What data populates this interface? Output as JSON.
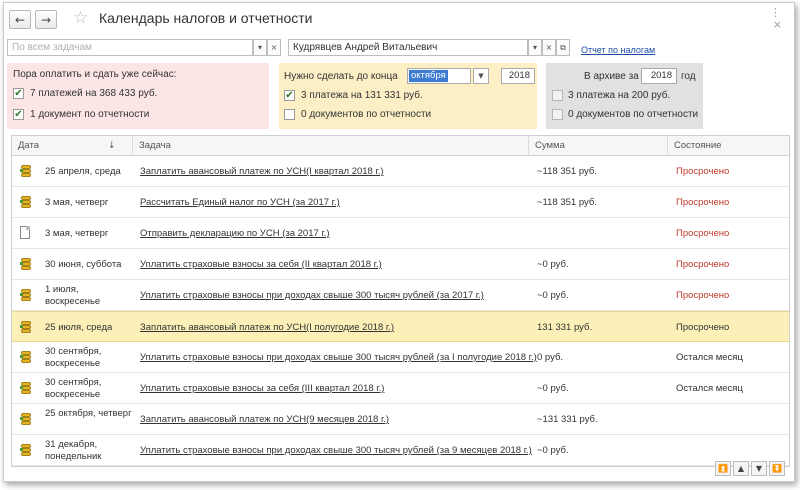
{
  "window": {
    "title": "Календарь налогов и отчетности"
  },
  "toolbar": {
    "back_glyph": "←",
    "forward_glyph": "→",
    "star_glyph": "☆",
    "more_glyph": "⋮",
    "close_glyph": "×"
  },
  "filter": {
    "task_placeholder": "По всем задачам",
    "person_value": "Кудрявцев Андрей Витальевич",
    "report_link": "Отчет по налогам"
  },
  "panel_now": {
    "label": "Пора оплатить и сдать уже сейчас:",
    "payments": "7 платежей на 368 433 руб.",
    "documents": "1 документ по отчетности"
  },
  "panel_todo": {
    "label": "Нужно сделать до конца",
    "month": "октября",
    "year": "2018",
    "payments": "3 платежа на 131 331 руб.",
    "documents": "0 документов по отчетности"
  },
  "panel_archive": {
    "label": "В архиве за",
    "year": "2018",
    "year_suffix": "год",
    "payments": "3 платежа на 200 руб.",
    "documents": "0 документов по отчетности"
  },
  "table": {
    "columns": {
      "date": "Дата",
      "task": "Задача",
      "sum": "Сумма",
      "state": "Состояние"
    },
    "rows": [
      {
        "date": "25 апреля, среда",
        "task": "Заплатить авансовый платеж по УСН(I квартал 2018 г.)",
        "sum": "~118 351 руб.",
        "state": "Просрочено",
        "icon": "coins-icon"
      },
      {
        "date": "3 мая, четверг",
        "task": "Рассчитать Единый налог по УСН (за 2017 г.)",
        "sum": "~118 351 руб.",
        "state": "Просрочено",
        "icon": "coins-icon"
      },
      {
        "date": "3 мая, четверг",
        "task": "Отправить декларацию по УСН (за 2017 г.)",
        "sum": "",
        "state": "Просрочено",
        "icon": "document-icon"
      },
      {
        "date": "30 июня, суббота",
        "task": "Уплатить страховые взносы за себя (II квартал 2018 г.)",
        "sum": "~0 руб.",
        "state": "Просрочено",
        "icon": "coins-icon"
      },
      {
        "date": "1 июля, воскресенье",
        "task": "Уплатить страховые взносы при доходах свыше 300 тысяч рублей (за 2017 г.)",
        "sum": "~0 руб.",
        "state": "Просрочено",
        "icon": "coins-icon"
      },
      {
        "date": "25 июля, среда",
        "task": "Заплатить авансовый платеж по УСН(I полугодие 2018 г.)",
        "sum": "131 331 руб.",
        "state": "Просрочено",
        "icon": "coins-icon"
      },
      {
        "date": "30 сентября, воскресенье",
        "task": "Уплатить страховые взносы при доходах свыше 300 тысяч рублей (за I полугодие 2018 г.)",
        "sum": "0 руб.",
        "state": "Остался месяц",
        "icon": "coins-icon"
      },
      {
        "date": "30 сентября, воскресенье",
        "task": "Уплатить страховые взносы за себя (III квартал 2018 г.)",
        "sum": "~0 руб.",
        "state": "Остался месяц",
        "icon": "coins-icon"
      },
      {
        "date": "25 октября, четверг",
        "task": "Заплатить авансовый платеж по УСН(9 месяцев 2018 г.)",
        "sum": "~131 331 руб.",
        "state": "",
        "icon": "coins-icon"
      },
      {
        "date": "31 декабря, понедельник",
        "task": "Уплатить страховые взносы при доходах свыше 300 тысяч рублей (за 9 месяцев 2018 г.)",
        "sum": "~0 руб.",
        "state": "",
        "icon": "coins-icon"
      }
    ]
  },
  "colors": {
    "overdue": "#c0392b",
    "highlight": "#fcf0b8",
    "link": "#1a4ea8"
  }
}
